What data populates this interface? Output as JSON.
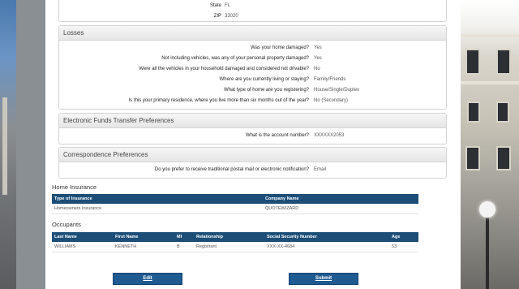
{
  "address": {
    "state_label": "State",
    "state_value": "FL",
    "zip_label": "ZIP",
    "zip_value": "33020"
  },
  "losses": {
    "title": "Losses",
    "rows": [
      {
        "q": "Was your home damaged?",
        "a": "Yes"
      },
      {
        "q": "Not including vehicles, was any of your personal property damaged?",
        "a": "Yes"
      },
      {
        "q": "Were all the vehicles in your household damaged and considered not drivable?",
        "a": "No"
      },
      {
        "q": "Where are you currently living or staying?",
        "a": "Family/Friends"
      },
      {
        "q": "What type of home are you registering?",
        "a": "House/Single/Duplex"
      },
      {
        "q": "Is this your primary residence, where you live more than six months out of the year?",
        "a": "No (Secondary)"
      }
    ]
  },
  "eft": {
    "title": "Electronic Funds Transfer Preferences",
    "rows": [
      {
        "q": "What is the account number?",
        "a": "XXXXXX2053"
      }
    ]
  },
  "correspondence": {
    "title": "Correspondence Preferences",
    "rows": [
      {
        "q": "Do you prefer to receive traditional postal mail or electronic notification?",
        "a": "Email"
      }
    ]
  },
  "home_insurance": {
    "title": "Home Insurance",
    "headers": [
      "Type of Insurance",
      "Company Name"
    ],
    "rows": [
      [
        "Homeowners Insurance",
        "QUOTEWIZARD"
      ]
    ]
  },
  "occupants": {
    "title": "Occupants",
    "headers": [
      "Last Name",
      "First Name",
      "MI",
      "Relationship",
      "Social Security Number",
      "Age"
    ],
    "rows": [
      [
        "WILLIAMS",
        "KENNETH",
        "B",
        "Registrant",
        "XXX-XX-4684",
        "53"
      ]
    ]
  },
  "buttons": {
    "edit": "Edit",
    "submit": "Submit"
  },
  "colors": {
    "table_header": "#1c4e78",
    "button": "#1f5a91"
  }
}
